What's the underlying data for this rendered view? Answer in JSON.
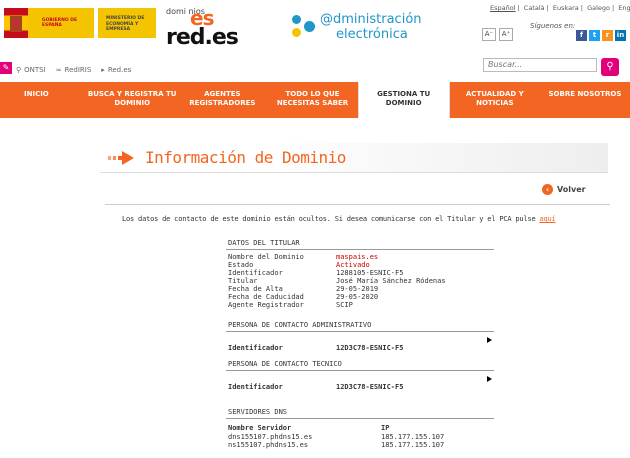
{
  "header": {
    "gobierno": "GOBIERNO DE ESPAÑA",
    "ministerio": "MINISTERIO DE ECONOMÍA Y EMPRESA",
    "brand_dominios": "domi nios",
    "brand_es": "es",
    "brand_red": "red.es",
    "admin_line1": "@dministración",
    "admin_line2": "electrónica",
    "languages": [
      "Español",
      "Català",
      "Euskara",
      "Galego",
      "English"
    ],
    "font_small": "A⁻",
    "font_large": "A⁺",
    "follow_label": "Síguenos en:",
    "social": [
      "f",
      "t",
      "r",
      "in"
    ]
  },
  "toolbar": {
    "items": [
      "ONTSI",
      "RedIRIS",
      "Red.es"
    ],
    "search_placeholder": "Buscar..."
  },
  "nav": {
    "items": [
      "INICIO",
      "BUSCA Y REGISTRA TU DOMINIO",
      "AGENTES REGISTRADORES",
      "TODO LO QUE NECESITAS SABER",
      "GESTIONA TU DOMINIO",
      "ACTUALIDAD Y NOTICIAS",
      "SOBRE NOSOTROS"
    ],
    "active_index": 4
  },
  "page": {
    "title": "Información de Dominio",
    "back_label": "Volver",
    "notice_text": "Los datos de contacto de este dominio están ocultos. Si desea comunicarse con el Titular y el PCA pulse",
    "notice_link": "aquí"
  },
  "titular": {
    "heading": "DATOS DEL TITULAR",
    "rows": [
      {
        "k": "Nombre del Dominio",
        "v": "maspais.es"
      },
      {
        "k": "Estado",
        "v": "Activado"
      },
      {
        "k": "Identificador",
        "v": "1288105-ESNIC-F5"
      },
      {
        "k": "Titular",
        "v": "José María Sánchez Ródenas"
      },
      {
        "k": "Fecha de Alta",
        "v": "29-05-2019"
      },
      {
        "k": "Fecha de Caducidad",
        "v": "29-05-2020"
      },
      {
        "k": "Agente Registrador",
        "v": "SCIP"
      }
    ]
  },
  "admin_contact": {
    "heading": "PERSONA DE CONTACTO ADMINISTRATIVO",
    "label": "Identificador",
    "value": "12D3C78-ESNIC-F5"
  },
  "tech_contact": {
    "heading": "PERSONA DE CONTACTO TECNICO",
    "label": "Identificador",
    "value": "12D3C78-ESNIC-F5"
  },
  "dns": {
    "heading": "SERVIDORES DNS",
    "col_server": "Nombre Servidor",
    "col_ip": "IP",
    "rows": [
      {
        "server": "dns155107.phdns15.es",
        "ip": "185.177.155.107"
      },
      {
        "server": "ns155107.phdns15.es",
        "ip": "185.177.155.107"
      }
    ]
  }
}
